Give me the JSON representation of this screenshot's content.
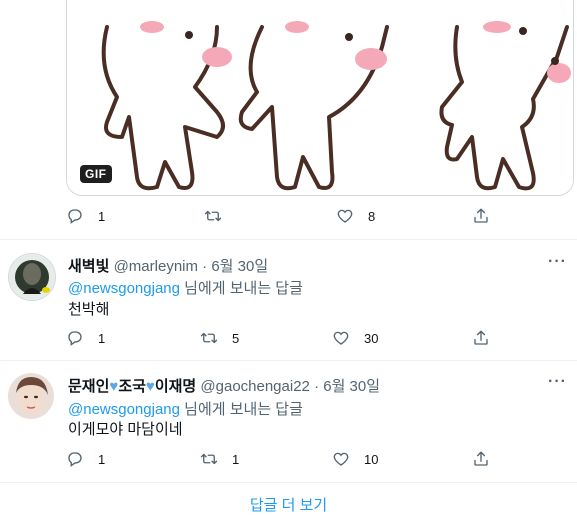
{
  "gif_card": {
    "badge": "GIF"
  },
  "first_actions": {
    "reply_count": "1",
    "retweet_count": "",
    "like_count": "8"
  },
  "tweets": [
    {
      "name": "새벽빛",
      "handle": "@marleynim",
      "date": "6월 30일",
      "reply_prefix": "@newsgongjang",
      "reply_suffix": " 님에게 보내는 답글",
      "text": "천박해",
      "reply_count": "1",
      "retweet_count": "5",
      "like_count": "30"
    },
    {
      "name_part1": "문재인",
      "name_part2": "조국",
      "name_part3": "이재명",
      "handle": "@gaochengai22",
      "date": "6월 30일",
      "reply_prefix": "@newsgongjang",
      "reply_suffix": " 님에게 보내는 답글",
      "text": "이게모야 마담이네",
      "reply_count": "1",
      "retweet_count": "1",
      "like_count": "10"
    }
  ],
  "more_label": "···",
  "separator": "·",
  "show_more": "답글 더 보기"
}
